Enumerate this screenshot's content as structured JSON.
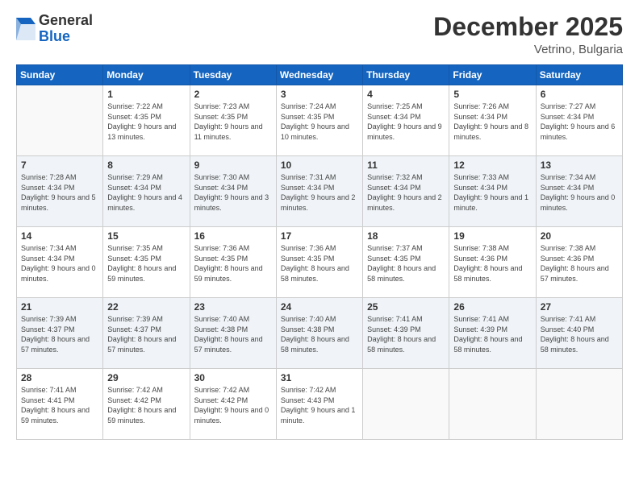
{
  "logo": {
    "general": "General",
    "blue": "Blue"
  },
  "header": {
    "month": "December 2025",
    "location": "Vetrino, Bulgaria"
  },
  "weekdays": [
    "Sunday",
    "Monday",
    "Tuesday",
    "Wednesday",
    "Thursday",
    "Friday",
    "Saturday"
  ],
  "weeks": [
    [
      {
        "day": "",
        "sunrise": "",
        "sunset": "",
        "daylight": ""
      },
      {
        "day": "1",
        "sunrise": "Sunrise: 7:22 AM",
        "sunset": "Sunset: 4:35 PM",
        "daylight": "Daylight: 9 hours and 13 minutes."
      },
      {
        "day": "2",
        "sunrise": "Sunrise: 7:23 AM",
        "sunset": "Sunset: 4:35 PM",
        "daylight": "Daylight: 9 hours and 11 minutes."
      },
      {
        "day": "3",
        "sunrise": "Sunrise: 7:24 AM",
        "sunset": "Sunset: 4:35 PM",
        "daylight": "Daylight: 9 hours and 10 minutes."
      },
      {
        "day": "4",
        "sunrise": "Sunrise: 7:25 AM",
        "sunset": "Sunset: 4:34 PM",
        "daylight": "Daylight: 9 hours and 9 minutes."
      },
      {
        "day": "5",
        "sunrise": "Sunrise: 7:26 AM",
        "sunset": "Sunset: 4:34 PM",
        "daylight": "Daylight: 9 hours and 8 minutes."
      },
      {
        "day": "6",
        "sunrise": "Sunrise: 7:27 AM",
        "sunset": "Sunset: 4:34 PM",
        "daylight": "Daylight: 9 hours and 6 minutes."
      }
    ],
    [
      {
        "day": "7",
        "sunrise": "Sunrise: 7:28 AM",
        "sunset": "Sunset: 4:34 PM",
        "daylight": "Daylight: 9 hours and 5 minutes."
      },
      {
        "day": "8",
        "sunrise": "Sunrise: 7:29 AM",
        "sunset": "Sunset: 4:34 PM",
        "daylight": "Daylight: 9 hours and 4 minutes."
      },
      {
        "day": "9",
        "sunrise": "Sunrise: 7:30 AM",
        "sunset": "Sunset: 4:34 PM",
        "daylight": "Daylight: 9 hours and 3 minutes."
      },
      {
        "day": "10",
        "sunrise": "Sunrise: 7:31 AM",
        "sunset": "Sunset: 4:34 PM",
        "daylight": "Daylight: 9 hours and 2 minutes."
      },
      {
        "day": "11",
        "sunrise": "Sunrise: 7:32 AM",
        "sunset": "Sunset: 4:34 PM",
        "daylight": "Daylight: 9 hours and 2 minutes."
      },
      {
        "day": "12",
        "sunrise": "Sunrise: 7:33 AM",
        "sunset": "Sunset: 4:34 PM",
        "daylight": "Daylight: 9 hours and 1 minute."
      },
      {
        "day": "13",
        "sunrise": "Sunrise: 7:34 AM",
        "sunset": "Sunset: 4:34 PM",
        "daylight": "Daylight: 9 hours and 0 minutes."
      }
    ],
    [
      {
        "day": "14",
        "sunrise": "Sunrise: 7:34 AM",
        "sunset": "Sunset: 4:34 PM",
        "daylight": "Daylight: 9 hours and 0 minutes."
      },
      {
        "day": "15",
        "sunrise": "Sunrise: 7:35 AM",
        "sunset": "Sunset: 4:35 PM",
        "daylight": "Daylight: 8 hours and 59 minutes."
      },
      {
        "day": "16",
        "sunrise": "Sunrise: 7:36 AM",
        "sunset": "Sunset: 4:35 PM",
        "daylight": "Daylight: 8 hours and 59 minutes."
      },
      {
        "day": "17",
        "sunrise": "Sunrise: 7:36 AM",
        "sunset": "Sunset: 4:35 PM",
        "daylight": "Daylight: 8 hours and 58 minutes."
      },
      {
        "day": "18",
        "sunrise": "Sunrise: 7:37 AM",
        "sunset": "Sunset: 4:35 PM",
        "daylight": "Daylight: 8 hours and 58 minutes."
      },
      {
        "day": "19",
        "sunrise": "Sunrise: 7:38 AM",
        "sunset": "Sunset: 4:36 PM",
        "daylight": "Daylight: 8 hours and 58 minutes."
      },
      {
        "day": "20",
        "sunrise": "Sunrise: 7:38 AM",
        "sunset": "Sunset: 4:36 PM",
        "daylight": "Daylight: 8 hours and 57 minutes."
      }
    ],
    [
      {
        "day": "21",
        "sunrise": "Sunrise: 7:39 AM",
        "sunset": "Sunset: 4:37 PM",
        "daylight": "Daylight: 8 hours and 57 minutes."
      },
      {
        "day": "22",
        "sunrise": "Sunrise: 7:39 AM",
        "sunset": "Sunset: 4:37 PM",
        "daylight": "Daylight: 8 hours and 57 minutes."
      },
      {
        "day": "23",
        "sunrise": "Sunrise: 7:40 AM",
        "sunset": "Sunset: 4:38 PM",
        "daylight": "Daylight: 8 hours and 57 minutes."
      },
      {
        "day": "24",
        "sunrise": "Sunrise: 7:40 AM",
        "sunset": "Sunset: 4:38 PM",
        "daylight": "Daylight: 8 hours and 58 minutes."
      },
      {
        "day": "25",
        "sunrise": "Sunrise: 7:41 AM",
        "sunset": "Sunset: 4:39 PM",
        "daylight": "Daylight: 8 hours and 58 minutes."
      },
      {
        "day": "26",
        "sunrise": "Sunrise: 7:41 AM",
        "sunset": "Sunset: 4:39 PM",
        "daylight": "Daylight: 8 hours and 58 minutes."
      },
      {
        "day": "27",
        "sunrise": "Sunrise: 7:41 AM",
        "sunset": "Sunset: 4:40 PM",
        "daylight": "Daylight: 8 hours and 58 minutes."
      }
    ],
    [
      {
        "day": "28",
        "sunrise": "Sunrise: 7:41 AM",
        "sunset": "Sunset: 4:41 PM",
        "daylight": "Daylight: 8 hours and 59 minutes."
      },
      {
        "day": "29",
        "sunrise": "Sunrise: 7:42 AM",
        "sunset": "Sunset: 4:42 PM",
        "daylight": "Daylight: 8 hours and 59 minutes."
      },
      {
        "day": "30",
        "sunrise": "Sunrise: 7:42 AM",
        "sunset": "Sunset: 4:42 PM",
        "daylight": "Daylight: 9 hours and 0 minutes."
      },
      {
        "day": "31",
        "sunrise": "Sunrise: 7:42 AM",
        "sunset": "Sunset: 4:43 PM",
        "daylight": "Daylight: 9 hours and 1 minute."
      },
      {
        "day": "",
        "sunrise": "",
        "sunset": "",
        "daylight": ""
      },
      {
        "day": "",
        "sunrise": "",
        "sunset": "",
        "daylight": ""
      },
      {
        "day": "",
        "sunrise": "",
        "sunset": "",
        "daylight": ""
      }
    ]
  ]
}
